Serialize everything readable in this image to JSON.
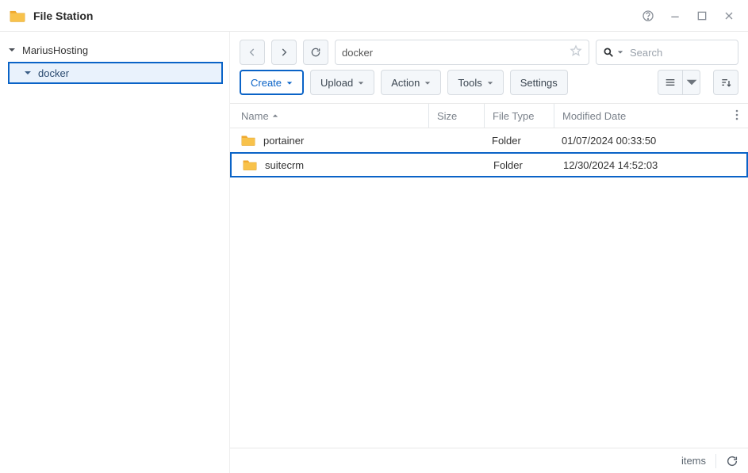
{
  "window": {
    "title": "File Station"
  },
  "tree": {
    "root": "MariusHosting",
    "child": "docker"
  },
  "path": {
    "value": "docker"
  },
  "search": {
    "placeholder": "Search"
  },
  "actions": {
    "create": "Create",
    "upload": "Upload",
    "action": "Action",
    "tools": "Tools",
    "settings": "Settings"
  },
  "columns": {
    "name": "Name",
    "size": "Size",
    "type": "File Type",
    "modified": "Modified Date"
  },
  "rows": [
    {
      "name": "portainer",
      "size": "",
      "type": "Folder",
      "modified": "01/07/2024 00:33:50",
      "selected": false
    },
    {
      "name": "suitecrm",
      "size": "",
      "type": "Folder",
      "modified": "12/30/2024 14:52:03",
      "selected": true
    }
  ],
  "status": {
    "items": "items"
  }
}
